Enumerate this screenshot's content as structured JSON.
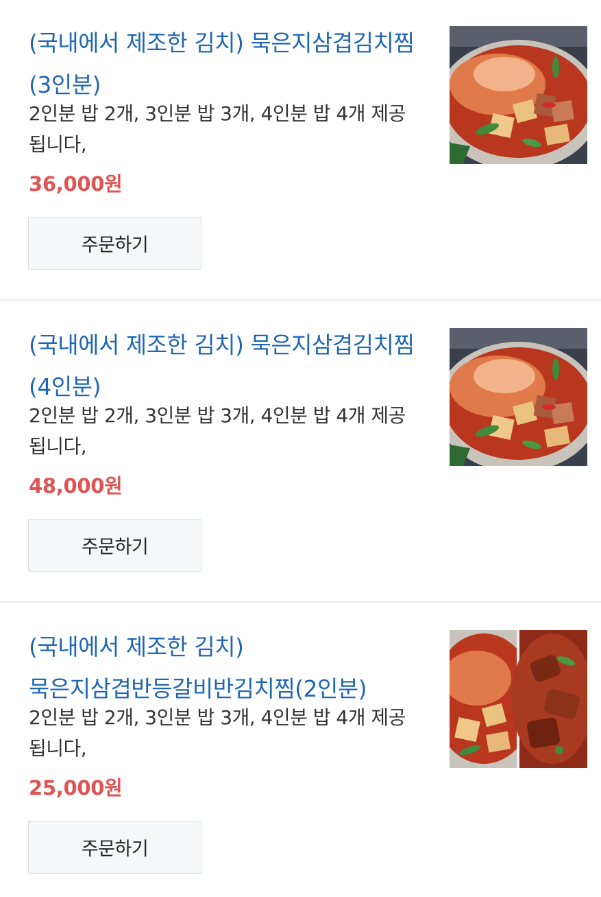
{
  "menu": {
    "items": [
      {
        "title": "(국내에서 제조한 김치) 묵은지삼겹김치찜(3인분)",
        "description": "2인분 밥 2개, 3인분 밥 3개, 4인분 밥 4개 제공 됩니다,",
        "price": "36,000원",
        "order_label": "주문하기",
        "image": "kimchi-stew-photo"
      },
      {
        "title": "(국내에서 제조한 김치) 묵은지삼겹김치찜(4인분)",
        "description": "2인분 밥 2개, 3인분 밥 3개, 4인분 밥 4개 제공 됩니다,",
        "price": "48,000원",
        "order_label": "주문하기",
        "image": "kimchi-stew-photo"
      },
      {
        "title": "(국내에서 제조한 김치) 묵은지삼겹반등갈비반김치찜(2인분)",
        "description": "2인분 밥 2개, 3인분 밥 3개, 4인분 밥 4개 제공 됩니다,",
        "price": "25,000원",
        "order_label": "주문하기",
        "image": "kimchi-stew-ribs-split-photo"
      }
    ]
  },
  "colors": {
    "title": "#1f66b3",
    "price": "#e05353",
    "button_bg": "#f6f7f9",
    "divider": "#e9e9ec"
  }
}
